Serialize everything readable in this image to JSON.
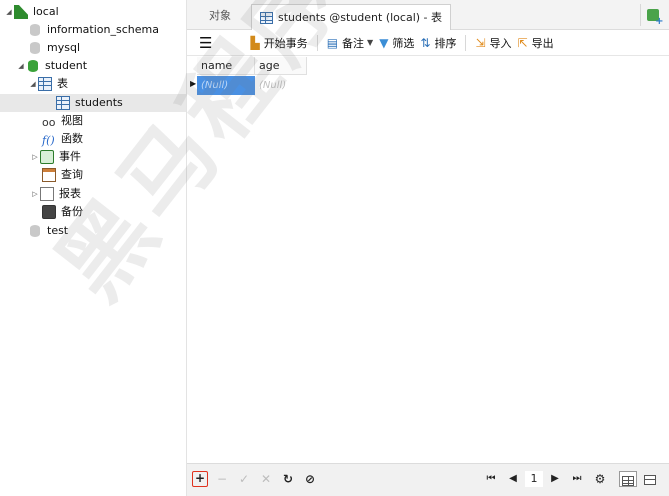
{
  "sidebar": {
    "items": [
      {
        "label": "local",
        "icon": "connection-icon",
        "expanded": true
      },
      {
        "label": "information_schema",
        "icon": "database-icon"
      },
      {
        "label": "mysql",
        "icon": "database-icon"
      },
      {
        "label": "student",
        "icon": "database-icon-active",
        "expanded": true
      },
      {
        "label": "表",
        "icon": "tables-icon",
        "expanded": true
      },
      {
        "label": "students",
        "icon": "table-icon",
        "selected": true
      },
      {
        "label": "视图",
        "icon": "views-icon"
      },
      {
        "label": "函数",
        "icon": "functions-icon"
      },
      {
        "label": "事件",
        "icon": "events-icon"
      },
      {
        "label": "查询",
        "icon": "queries-icon"
      },
      {
        "label": "报表",
        "icon": "reports-icon"
      },
      {
        "label": "备份",
        "icon": "backups-icon"
      },
      {
        "label": "test",
        "icon": "database-icon"
      }
    ]
  },
  "tabs": {
    "objects": "对象",
    "table": "students @student (local) - 表"
  },
  "toolbar": {
    "begin_transaction": "开始事务",
    "note": "备注",
    "filter": "筛选",
    "sort": "排序",
    "import": "导入",
    "export": "导出"
  },
  "grid": {
    "columns": [
      "name",
      "age"
    ],
    "rows": [
      [
        "(Null)",
        "(Null)"
      ]
    ]
  },
  "pager": {
    "page": "1"
  },
  "watermark": "黑马程序员",
  "colors": {
    "selected_cell": "#4a90e2",
    "add_button_border": "#e0321e",
    "database_active": "#3aa23a"
  }
}
